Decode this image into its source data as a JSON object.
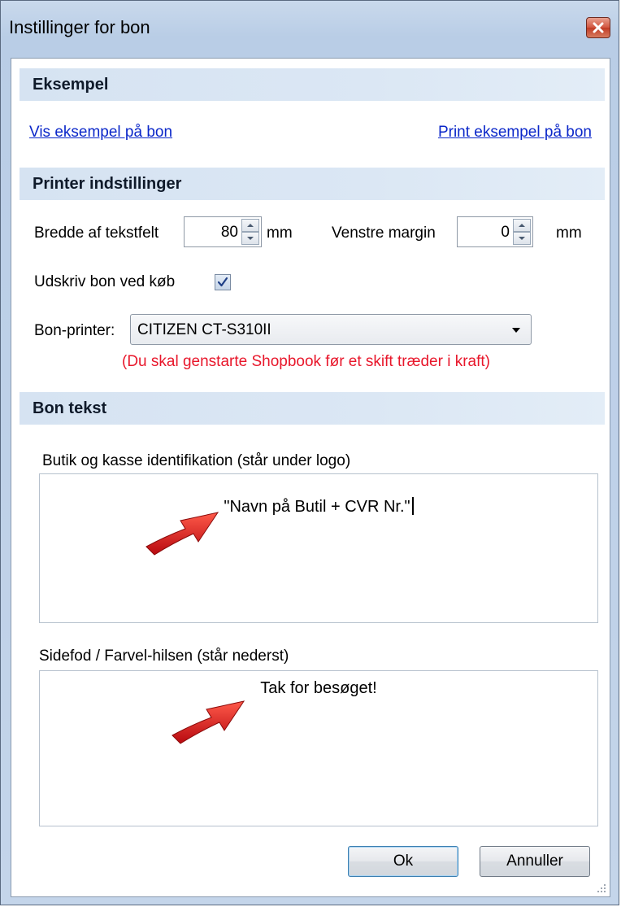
{
  "window": {
    "title": "Instillinger for bon"
  },
  "sections": {
    "eksempel": {
      "header": "Eksempel",
      "show_link": "Vis eksempel på bon",
      "print_link": "Print eksempel på bon"
    },
    "printer": {
      "header": "Printer indstillinger",
      "width_label": "Bredde af tekstfelt",
      "width_value": "80",
      "width_unit": "mm",
      "margin_label": "Venstre margin",
      "margin_value": "0",
      "margin_unit": "mm",
      "print_on_purchase_label": "Udskriv bon ved køb",
      "print_on_purchase_checked": true,
      "printer_label": "Bon-printer:",
      "printer_selected": "CITIZEN CT-S310II",
      "restart_warning": "(Du skal genstarte Shopbook før et skift træder i kraft)"
    },
    "bon_tekst": {
      "header": "Bon tekst",
      "shop_id_label": "Butik og kasse identifikation (står under logo)",
      "shop_id_value": "\"Navn på Butil + CVR Nr.\"",
      "footer_label": "Sidefod / Farvel-hilsen (står nederst)",
      "footer_value": "Tak for besøget!"
    }
  },
  "buttons": {
    "ok": "Ok",
    "cancel": "Annuller"
  },
  "colors": {
    "link": "#0b27c9",
    "warning": "#e8172b",
    "section_header_bg": "#d6e3f2",
    "annotation_arrow": "#e0141b"
  },
  "icons": {
    "close": "close-icon",
    "spin_up": "chevron-up-icon",
    "spin_down": "chevron-down-icon",
    "dropdown": "dropdown-arrow-icon",
    "check": "checkmark-icon",
    "annotation": "red-arrow-icon",
    "resize": "resize-grip-icon"
  }
}
